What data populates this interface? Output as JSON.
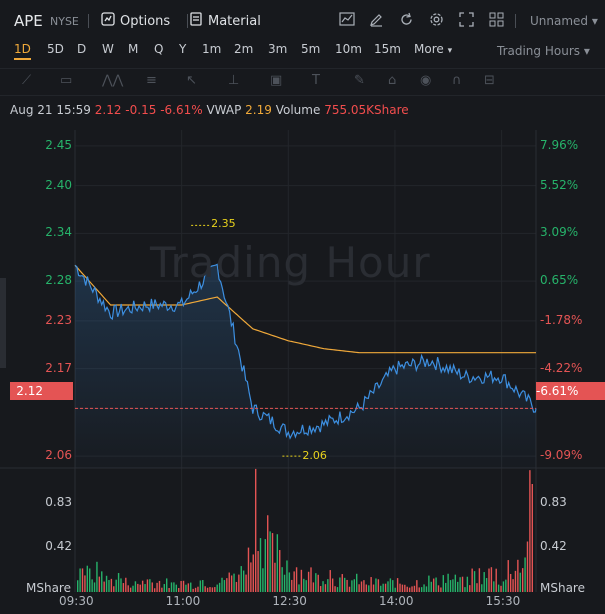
{
  "header": {
    "symbol": "APE",
    "exchange": "NYSE",
    "options_label": "Options",
    "material_label": "Material",
    "layout_name": "Unnamed"
  },
  "timeframes": [
    "1D",
    "5D",
    "D",
    "W",
    "M",
    "Q",
    "Y",
    "1m",
    "2m",
    "3m",
    "5m",
    "10m",
    "15m",
    "More"
  ],
  "active_timeframe": "1D",
  "session_label": "Trading Hours",
  "info": {
    "datetime": "Aug 21 15:59",
    "price": "2.12",
    "change": "-0.15",
    "change_pct": "-6.61%",
    "vwap_label": "VWAP",
    "vwap": "2.19",
    "volume_label": "Volume",
    "volume": "755.05KShare"
  },
  "watermark": "Trading Hour",
  "colors": {
    "up": "#26b36a",
    "down": "#e45454",
    "price_line": "#3d8fe0",
    "vwap_line": "#f0a93a",
    "hl_marker": "#e8d21d"
  },
  "chart_data": {
    "type": "line",
    "x": [
      "09:30",
      "10:00",
      "10:30",
      "11:00",
      "11:30",
      "12:00",
      "12:30",
      "13:00",
      "13:30",
      "14:00",
      "14:30",
      "15:00",
      "15:30",
      "15:59"
    ],
    "series": [
      {
        "values": [
          2.3,
          2.24,
          2.25,
          2.25,
          2.3,
          2.12,
          2.09,
          2.1,
          2.12,
          2.17,
          2.18,
          2.16,
          2.16,
          2.12
        ]
      },
      {
        "values": [
          2.3,
          2.25,
          2.25,
          2.25,
          2.26,
          2.22,
          2.205,
          2.195,
          2.19,
          2.19,
          2.19,
          2.19,
          2.19,
          2.19
        ]
      }
    ],
    "high_label": "2.35",
    "low_label": "2.06",
    "left_ticks": [
      "2.45",
      "2.40",
      "2.34",
      "2.28",
      "2.23",
      "2.17",
      "2.12",
      "2.06"
    ],
    "right_ticks": [
      "7.96%",
      "5.52%",
      "3.09%",
      "0.65%",
      "-1.78%",
      "-4.22%",
      "-6.61%",
      "-9.09%"
    ],
    "current_price": "2.12",
    "current_pct": "-6.61%",
    "volume_ticks": [
      "0.83",
      "0.42"
    ],
    "volume_unit": "MShare",
    "x_ticks": [
      "09:30",
      "11:00",
      "12:30",
      "14:00",
      "15:30"
    ],
    "ylim": [
      2.045,
      2.47
    ],
    "volume_max": 1.1,
    "volume_bars_sample": [
      0.22,
      0.18,
      0.2,
      0.12,
      0.15,
      0.1,
      0.08,
      0.12,
      0.1,
      0.09,
      0.07,
      0.1,
      0.08,
      0.12,
      0.09,
      0.1,
      0.15,
      0.2,
      0.35,
      1.0,
      0.6,
      0.4,
      0.3,
      0.25,
      0.2,
      0.18,
      0.15,
      0.2,
      0.12,
      0.1,
      0.12,
      0.09,
      0.1,
      0.08,
      0.1,
      0.09,
      0.08,
      0.1,
      0.12,
      0.1,
      0.15,
      0.12,
      0.1,
      0.18,
      0.15,
      0.2,
      0.12,
      0.25,
      0.3,
      0.8
    ]
  }
}
